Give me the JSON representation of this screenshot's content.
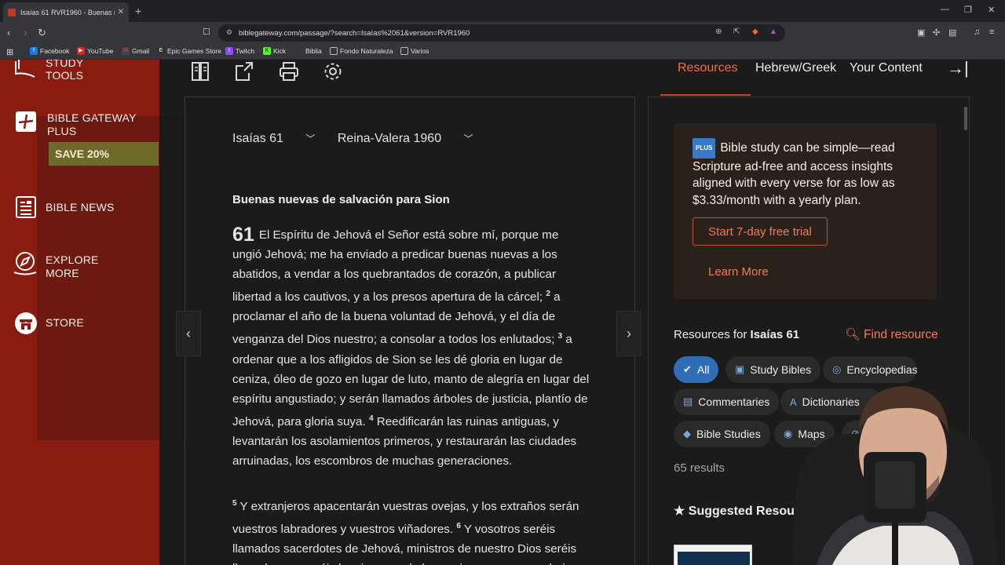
{
  "browser": {
    "tab_title": "Isaías 61 RVR1960 - Buenas nue...",
    "url": "biblegateway.com/passage/?search=Isaías%2061&version=RVR1960",
    "bookmarks": [
      "Facebook",
      "YouTube",
      "Gmail",
      "Epic Games Store",
      "Twitch",
      "Kick",
      "Biblia",
      "Fondo Naturaleza",
      "Varios"
    ]
  },
  "sidebar": {
    "study_tools_1": "STUDY",
    "study_tools_2": "TOOLS",
    "plus_1": "BIBLE GATEWAY",
    "plus_2": "PLUS",
    "save": "SAVE 20%",
    "news": "BIBLE NEWS",
    "explore_1": "EXPLORE",
    "explore_2": "MORE",
    "store": "STORE"
  },
  "passage": {
    "chapter_select": "Isaías 61",
    "version_select": "Reina-Valera 1960",
    "heading": "Buenas nuevas de salvación para Sion",
    "chapter_num": "61",
    "v1": "El Espíritu de Jehová el Señor está sobre mí, porque me ungió Jehová; me ha enviado a predicar buenas nuevas a los abatidos, a vendar a los quebrantados de corazón, a publicar libertad a los cautivos, y a los presos apertura de la cárcel;",
    "n2": "2",
    "v2": "a proclamar el año de la buena voluntad de Jehová, y el día de venganza del Dios nuestro; a consolar a todos los enlutados;",
    "n3": "3",
    "v3": "a ordenar que a los afligidos de Sion se les dé gloria en lugar de ceniza, óleo de gozo en lugar de luto, manto de alegría en lugar del espíritu angustiado; y serán llamados árboles de justicia, plantío de Jehová, para gloria suya.",
    "n4": "4",
    "v4": "Reedificarán las ruinas antiguas, y levantarán los asolamientos primeros, y restaurarán las ciudades arruinadas, los escombros de muchas generaciones.",
    "n5": "5",
    "v5": "Y extranjeros apacentarán vuestras ovejas, y los extraños serán vuestros labradores y vuestros viñadores.",
    "n6": "6",
    "v6": "Y vosotros seréis llamados sacerdotes de Jehová, ministros de nuestro Dios seréis llamados; comeréis las riquezas de las naciones, y con su gloria"
  },
  "right_nav": {
    "resources": "Resources",
    "hebrew_greek": "Hebrew/Greek",
    "your_content": "Your Content"
  },
  "promo": {
    "badge": "PLUS",
    "text": "Bible study can be simple—read Scripture ad-free and access insights aligned with every verse for as low as $3.33/month with a yearly plan.",
    "trial": "Start 7-day free trial",
    "learn": "Learn More"
  },
  "resources": {
    "prefix": "Resources for ",
    "ref": "Isaías 61",
    "find": "Find resource",
    "chips": [
      "All",
      "Study Bibles",
      "Encyclopedias",
      "Commentaries",
      "Dictionaries",
      "Bible Studies",
      "Maps"
    ],
    "results": "65 results",
    "suggested": "Suggested Resources"
  }
}
